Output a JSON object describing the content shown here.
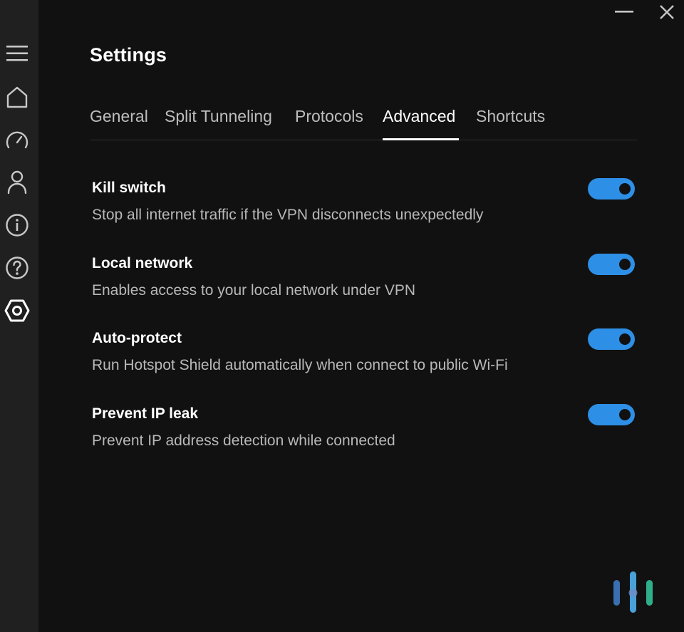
{
  "window": {
    "minimize_icon": "minimize-icon",
    "close_icon": "close-icon"
  },
  "sidebar": {
    "items": [
      {
        "id": "menu",
        "icon": "hamburger-menu-icon"
      },
      {
        "id": "home",
        "icon": "home-icon"
      },
      {
        "id": "speed",
        "icon": "speedometer-icon"
      },
      {
        "id": "account",
        "icon": "user-icon"
      },
      {
        "id": "info",
        "icon": "info-icon"
      },
      {
        "id": "help",
        "icon": "help-icon"
      },
      {
        "id": "settings",
        "icon": "settings-hexagon-icon",
        "active": true
      }
    ]
  },
  "page": {
    "title": "Settings"
  },
  "tabs": [
    {
      "label": "General",
      "active": false
    },
    {
      "label": "Split Tunneling",
      "active": false
    },
    {
      "label": "Protocols",
      "active": false
    },
    {
      "label": "Advanced",
      "active": true
    },
    {
      "label": "Shortcuts",
      "active": false
    }
  ],
  "settings": [
    {
      "title": "Kill switch",
      "description": "Stop all internet traffic if the VPN disconnects unexpectedly",
      "enabled": true
    },
    {
      "title": "Local network",
      "description": "Enables access to your local network under VPN",
      "enabled": true
    },
    {
      "title": "Auto-protect",
      "description": "Run Hotspot Shield automatically when connect to public Wi-Fi",
      "enabled": true
    },
    {
      "title": "Prevent IP leak",
      "description": "Prevent IP address detection while connected",
      "enabled": true
    }
  ],
  "colors": {
    "background": "#111111",
    "sidebar": "#202020",
    "toggle_on": "#2e8fe6",
    "text_primary": "#ffffff",
    "text_secondary": "#b8b8b8"
  },
  "watermark": {
    "icon": "brand-bars-logo-icon",
    "colors": [
      "#3a6fb0",
      "#4aa0d8",
      "#2fae8a"
    ]
  }
}
